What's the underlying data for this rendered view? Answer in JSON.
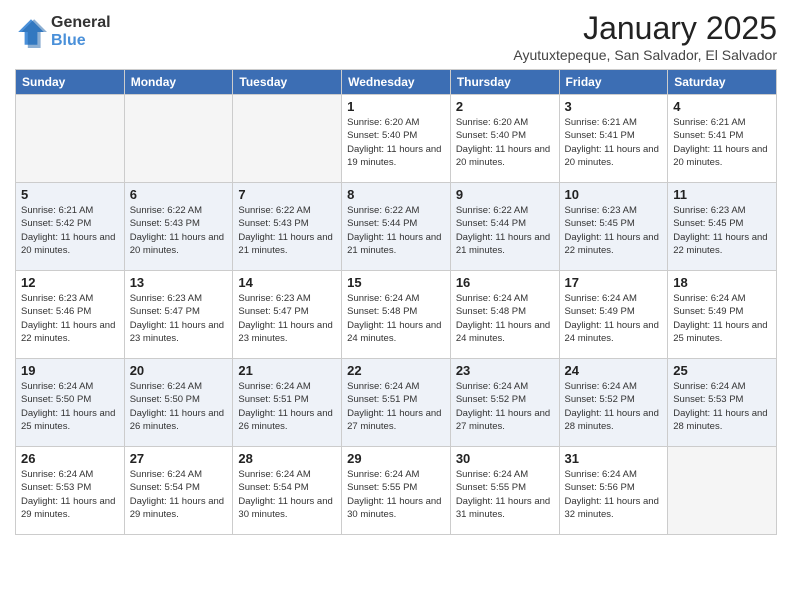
{
  "logo": {
    "general": "General",
    "blue": "Blue"
  },
  "header": {
    "month": "January 2025",
    "location": "Ayutuxtepeque, San Salvador, El Salvador"
  },
  "days_of_week": [
    "Sunday",
    "Monday",
    "Tuesday",
    "Wednesday",
    "Thursday",
    "Friday",
    "Saturday"
  ],
  "weeks": [
    {
      "alt": false,
      "days": [
        {
          "num": "",
          "empty": true
        },
        {
          "num": "",
          "empty": true
        },
        {
          "num": "",
          "empty": true
        },
        {
          "num": "1",
          "sunrise": "6:20 AM",
          "sunset": "5:40 PM",
          "daylight": "11 hours and 19 minutes."
        },
        {
          "num": "2",
          "sunrise": "6:20 AM",
          "sunset": "5:40 PM",
          "daylight": "11 hours and 20 minutes."
        },
        {
          "num": "3",
          "sunrise": "6:21 AM",
          "sunset": "5:41 PM",
          "daylight": "11 hours and 20 minutes."
        },
        {
          "num": "4",
          "sunrise": "6:21 AM",
          "sunset": "5:41 PM",
          "daylight": "11 hours and 20 minutes."
        }
      ]
    },
    {
      "alt": true,
      "days": [
        {
          "num": "5",
          "sunrise": "6:21 AM",
          "sunset": "5:42 PM",
          "daylight": "11 hours and 20 minutes."
        },
        {
          "num": "6",
          "sunrise": "6:22 AM",
          "sunset": "5:43 PM",
          "daylight": "11 hours and 20 minutes."
        },
        {
          "num": "7",
          "sunrise": "6:22 AM",
          "sunset": "5:43 PM",
          "daylight": "11 hours and 21 minutes."
        },
        {
          "num": "8",
          "sunrise": "6:22 AM",
          "sunset": "5:44 PM",
          "daylight": "11 hours and 21 minutes."
        },
        {
          "num": "9",
          "sunrise": "6:22 AM",
          "sunset": "5:44 PM",
          "daylight": "11 hours and 21 minutes."
        },
        {
          "num": "10",
          "sunrise": "6:23 AM",
          "sunset": "5:45 PM",
          "daylight": "11 hours and 22 minutes."
        },
        {
          "num": "11",
          "sunrise": "6:23 AM",
          "sunset": "5:45 PM",
          "daylight": "11 hours and 22 minutes."
        }
      ]
    },
    {
      "alt": false,
      "days": [
        {
          "num": "12",
          "sunrise": "6:23 AM",
          "sunset": "5:46 PM",
          "daylight": "11 hours and 22 minutes."
        },
        {
          "num": "13",
          "sunrise": "6:23 AM",
          "sunset": "5:47 PM",
          "daylight": "11 hours and 23 minutes."
        },
        {
          "num": "14",
          "sunrise": "6:23 AM",
          "sunset": "5:47 PM",
          "daylight": "11 hours and 23 minutes."
        },
        {
          "num": "15",
          "sunrise": "6:24 AM",
          "sunset": "5:48 PM",
          "daylight": "11 hours and 24 minutes."
        },
        {
          "num": "16",
          "sunrise": "6:24 AM",
          "sunset": "5:48 PM",
          "daylight": "11 hours and 24 minutes."
        },
        {
          "num": "17",
          "sunrise": "6:24 AM",
          "sunset": "5:49 PM",
          "daylight": "11 hours and 24 minutes."
        },
        {
          "num": "18",
          "sunrise": "6:24 AM",
          "sunset": "5:49 PM",
          "daylight": "11 hours and 25 minutes."
        }
      ]
    },
    {
      "alt": true,
      "days": [
        {
          "num": "19",
          "sunrise": "6:24 AM",
          "sunset": "5:50 PM",
          "daylight": "11 hours and 25 minutes."
        },
        {
          "num": "20",
          "sunrise": "6:24 AM",
          "sunset": "5:50 PM",
          "daylight": "11 hours and 26 minutes."
        },
        {
          "num": "21",
          "sunrise": "6:24 AM",
          "sunset": "5:51 PM",
          "daylight": "11 hours and 26 minutes."
        },
        {
          "num": "22",
          "sunrise": "6:24 AM",
          "sunset": "5:51 PM",
          "daylight": "11 hours and 27 minutes."
        },
        {
          "num": "23",
          "sunrise": "6:24 AM",
          "sunset": "5:52 PM",
          "daylight": "11 hours and 27 minutes."
        },
        {
          "num": "24",
          "sunrise": "6:24 AM",
          "sunset": "5:52 PM",
          "daylight": "11 hours and 28 minutes."
        },
        {
          "num": "25",
          "sunrise": "6:24 AM",
          "sunset": "5:53 PM",
          "daylight": "11 hours and 28 minutes."
        }
      ]
    },
    {
      "alt": false,
      "days": [
        {
          "num": "26",
          "sunrise": "6:24 AM",
          "sunset": "5:53 PM",
          "daylight": "11 hours and 29 minutes."
        },
        {
          "num": "27",
          "sunrise": "6:24 AM",
          "sunset": "5:54 PM",
          "daylight": "11 hours and 29 minutes."
        },
        {
          "num": "28",
          "sunrise": "6:24 AM",
          "sunset": "5:54 PM",
          "daylight": "11 hours and 30 minutes."
        },
        {
          "num": "29",
          "sunrise": "6:24 AM",
          "sunset": "5:55 PM",
          "daylight": "11 hours and 30 minutes."
        },
        {
          "num": "30",
          "sunrise": "6:24 AM",
          "sunset": "5:55 PM",
          "daylight": "11 hours and 31 minutes."
        },
        {
          "num": "31",
          "sunrise": "6:24 AM",
          "sunset": "5:56 PM",
          "daylight": "11 hours and 32 minutes."
        },
        {
          "num": "",
          "empty": true
        }
      ]
    }
  ]
}
